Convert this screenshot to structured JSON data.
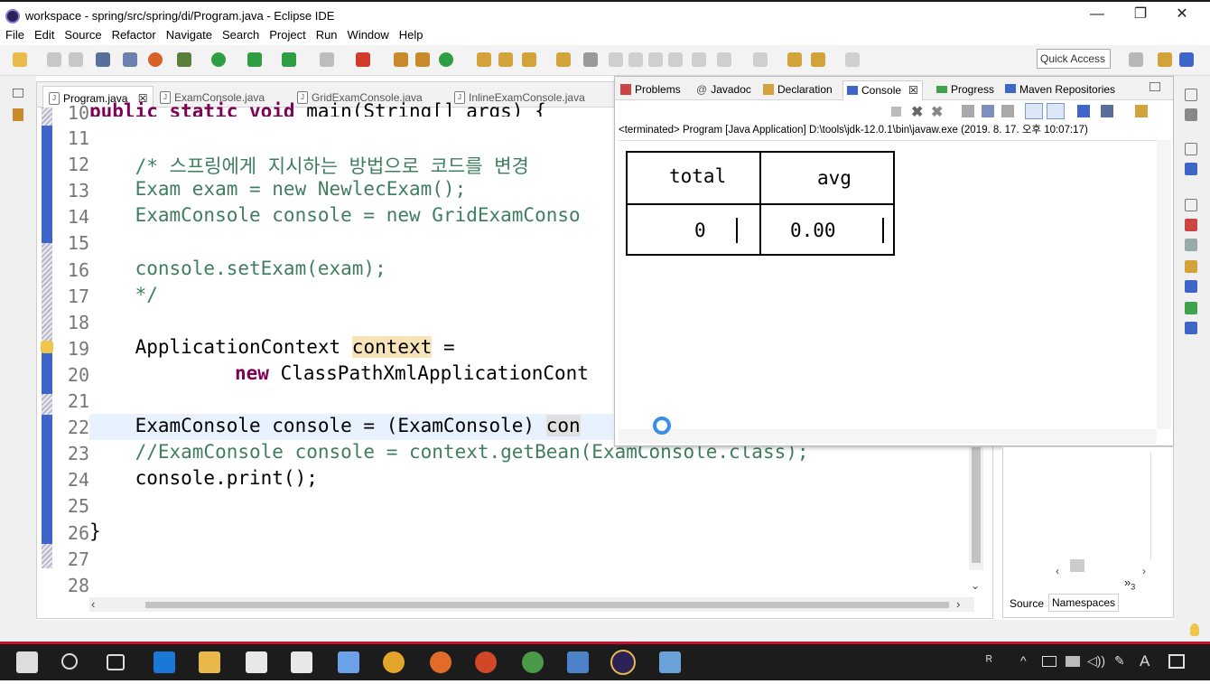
{
  "window": {
    "title": "workspace - spring/src/spring/di/Program.java - Eclipse IDE",
    "minimize": "—",
    "maximize": "❐",
    "close": "✕"
  },
  "menu": [
    "File",
    "Edit",
    "Source",
    "Refactor",
    "Navigate",
    "Search",
    "Project",
    "Run",
    "Window",
    "Help"
  ],
  "toolbar": {
    "quick_access": "Quick Access"
  },
  "editor": {
    "tabs": [
      {
        "label": "Program.java",
        "close": "☒",
        "active": true
      },
      {
        "label": "ExamConsole.java",
        "active": false
      },
      {
        "label": "GridExamConsole.java",
        "active": false
      },
      {
        "label": "InlineExamConsole.java",
        "active": false
      }
    ],
    "line_numbers": [
      "10",
      "11",
      "12",
      "13",
      "14",
      "15",
      "16",
      "17",
      "18",
      "19",
      "20",
      "21",
      "22",
      "23",
      "24",
      "25",
      "26",
      "27",
      "28"
    ],
    "code": {
      "l10_a": "public static void",
      "l10_b": " main(String[] args) {",
      "l12": "    /* 스프링에게 지시하는 방법으로 코드를 변경",
      "l13": "    Exam exam = new NewlecExam();",
      "l14": "    ExamConsole console = new GridExamConso",
      "l16": "    console.setExam(exam);",
      "l17": "    */",
      "l19_a": "    ApplicationContext ",
      "l19_b": "context",
      "l19_c": " =",
      "l20_kw": "new",
      "l20_b": " ClassPathXmlApplicationCont",
      "l22_a": "    ExamConsole console = (ExamConsole) ",
      "l22_b": "con",
      "l23": "    //ExamConsole console = context.getBean(ExamConsole.class);",
      "l24": "    console.print();",
      "l26": "}"
    }
  },
  "console": {
    "tabs": [
      {
        "label": "Problems",
        "active": false
      },
      {
        "label": "Javadoc",
        "active": false
      },
      {
        "label": "Declaration",
        "active": false
      },
      {
        "label": "Console",
        "close": "☒",
        "active": true
      },
      {
        "label": "Progress",
        "active": false
      },
      {
        "label": "Maven Repositories",
        "active": false
      }
    ],
    "terminated_line": "<terminated> Program [Java Application] D:\\tools\\jdk-12.0.1\\bin\\javaw.exe (2019. 8. 17. 오후 10:07:17)",
    "table": {
      "headers": [
        "total",
        "avg"
      ],
      "row": [
        "0",
        "0.00"
      ]
    }
  },
  "outline": {
    "tabs": [
      {
        "label": "Source",
        "active": false
      },
      {
        "label": "Namespaces",
        "active": true
      }
    ],
    "overflow": "»",
    "overflow_count": "3"
  },
  "colors": {
    "keyword": "#7f0055",
    "comment": "#3f7f5f",
    "occurrence_highlight": "#f7e4b8",
    "taskbar": "#1c1c1c",
    "taskbar_accent": "#c8102e"
  },
  "taskbar": {
    "icons": [
      "windows-start-icon",
      "search-icon",
      "task-view-icon",
      "edge-icon",
      "file-explorer-icon",
      "store-icon",
      "mail-icon",
      "network-app-icon",
      "chrome-icon",
      "firefox-icon",
      "powerpoint-icon",
      "chrome-alt-icon",
      "remote-desktop-icon",
      "eclipse-icon",
      "notes-icon"
    ],
    "tray_input": "A"
  }
}
